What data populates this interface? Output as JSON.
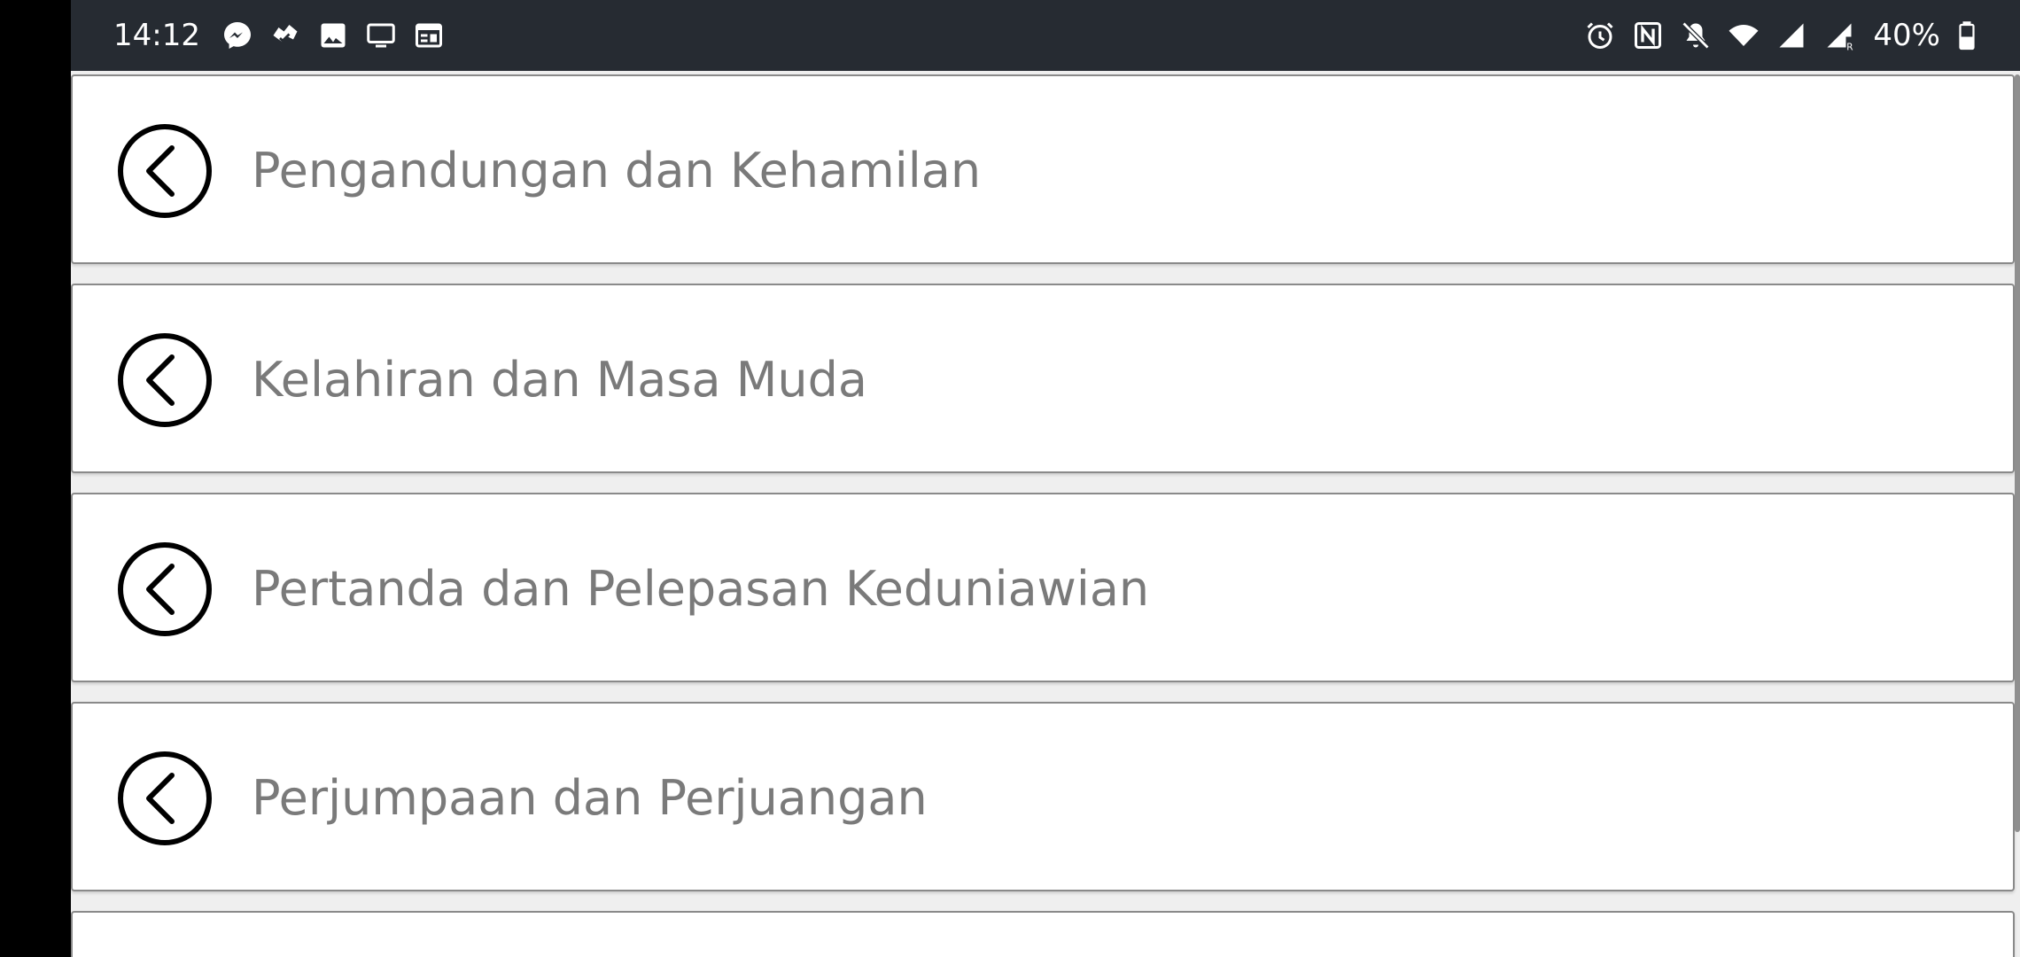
{
  "status_bar": {
    "time": "14:12",
    "battery_percent": "40%",
    "left_icons": [
      "messenger-icon",
      "tasks-icon",
      "gallery-icon",
      "cast-icon",
      "calendar-icon"
    ],
    "right_icons": [
      "alarm-icon",
      "nfc-icon",
      "mute-icon",
      "wifi-icon",
      "signal-icon",
      "signal-roaming-icon",
      "battery-icon"
    ],
    "background_color": "#262b32"
  },
  "list": {
    "items": [
      {
        "label": "Pengandungan dan Kehamilan",
        "icon": "chevron-left-circle-icon"
      },
      {
        "label": "Kelahiran dan Masa Muda",
        "icon": "chevron-left-circle-icon"
      },
      {
        "label": "Pertanda dan Pelepasan Keduniawian",
        "icon": "chevron-left-circle-icon"
      },
      {
        "label": "Perjumpaan dan Perjuangan",
        "icon": "chevron-left-circle-icon"
      },
      {
        "label": "",
        "icon": ""
      }
    ],
    "text_color": "#7a7a7a"
  }
}
